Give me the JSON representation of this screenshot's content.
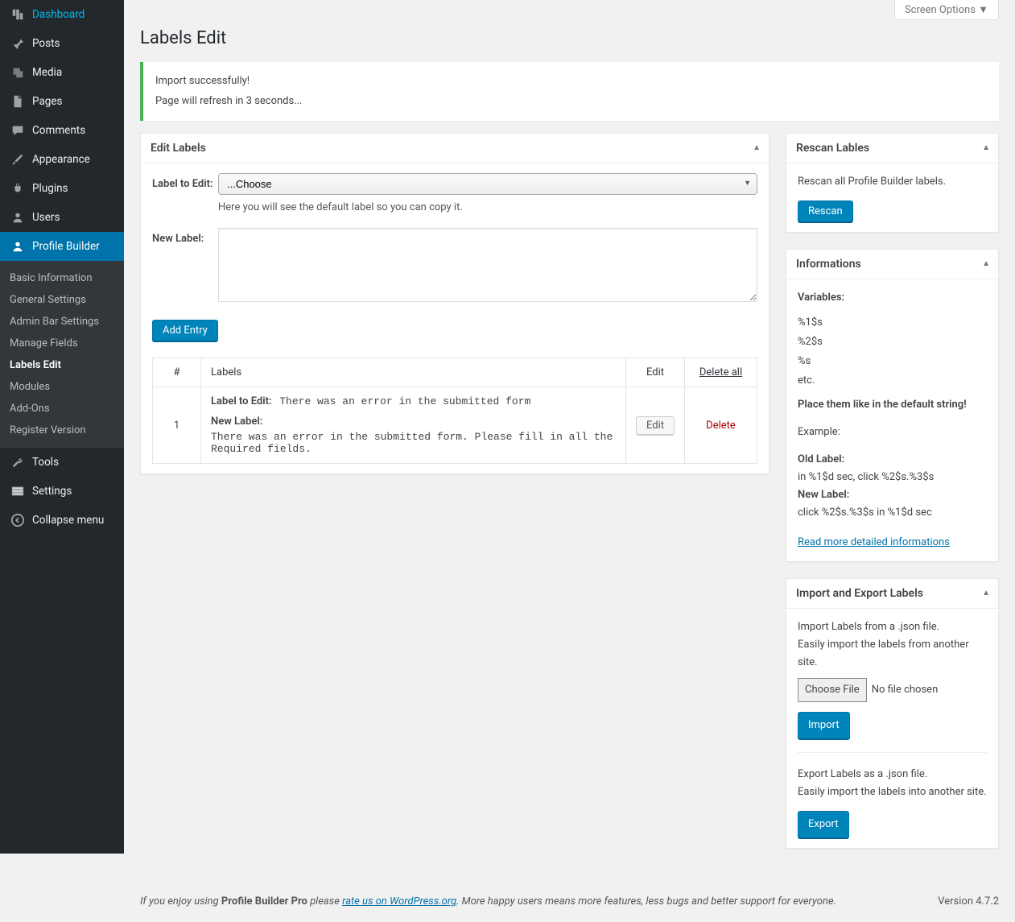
{
  "screen_options": "Screen Options ▼",
  "page_title": "Labels Edit",
  "notice": {
    "line1": "Import successfully!",
    "line2": "Page will refresh in 3 seconds..."
  },
  "sidebar": {
    "items": [
      {
        "label": "Dashboard"
      },
      {
        "label": "Posts"
      },
      {
        "label": "Media"
      },
      {
        "label": "Pages"
      },
      {
        "label": "Comments"
      },
      {
        "label": "Appearance"
      },
      {
        "label": "Plugins"
      },
      {
        "label": "Users"
      },
      {
        "label": "Profile Builder"
      },
      {
        "label": "Tools"
      },
      {
        "label": "Settings"
      },
      {
        "label": "Collapse menu"
      }
    ],
    "submenu": [
      {
        "label": "Basic Information"
      },
      {
        "label": "General Settings"
      },
      {
        "label": "Admin Bar Settings"
      },
      {
        "label": "Manage Fields"
      },
      {
        "label": "Labels Edit"
      },
      {
        "label": "Modules"
      },
      {
        "label": "Add-Ons"
      },
      {
        "label": "Register Version"
      }
    ]
  },
  "edit_labels": {
    "title": "Edit Labels",
    "label_to_edit": "Label to Edit:",
    "choose": "...Choose",
    "hint": "Here you will see the default label so you can copy it.",
    "new_label": "New Label:",
    "add_entry": "Add Entry",
    "table": {
      "col_num": "#",
      "col_labels": "Labels",
      "col_edit": "Edit",
      "col_delete_all": "Delete all",
      "rows": [
        {
          "num": "1",
          "label_to_edit_label": "Label to Edit:",
          "label_to_edit_value": "There was an error in the submitted form",
          "new_label_label": "New Label:",
          "new_label_value": "There was an error in the submitted form. Please fill in all the Required fields.",
          "edit": "Edit",
          "delete": "Delete"
        }
      ]
    }
  },
  "rescan": {
    "title": "Rescan Lables",
    "desc": "Rescan all Profile Builder labels.",
    "button": "Rescan"
  },
  "informations": {
    "title": "Informations",
    "variables_label": "Variables:",
    "vars": [
      "%1$s",
      "%2$s",
      "%s",
      "etc."
    ],
    "place_line": "Place them like in the default string!",
    "example_label": "Example:",
    "old_label_label": "Old Label:",
    "old_label_value": "in %1$d sec, click %2$s.%3$s",
    "new_label_label": "New Label:",
    "new_label_value": "click %2$s.%3$s in %1$d sec",
    "read_more": "Read more detailed informations"
  },
  "import_export": {
    "title": "Import and Export Labels",
    "import_desc1": "Import Labels from a .json file.",
    "import_desc2": "Easily import the labels from another site.",
    "choose_file": "Choose File",
    "no_file": "No file chosen",
    "import_btn": "Import",
    "export_desc1": "Export Labels as a .json file.",
    "export_desc2": "Easily import the labels into another site.",
    "export_btn": "Export"
  },
  "footer": {
    "prefix": "If you enjoy using ",
    "product": "Profile Builder Pro",
    "mid": " please ",
    "link": "rate us on WordPress.org",
    "suffix": ". More happy users means more features, less bugs and better support for everyone.",
    "version": "Version 4.7.2"
  }
}
